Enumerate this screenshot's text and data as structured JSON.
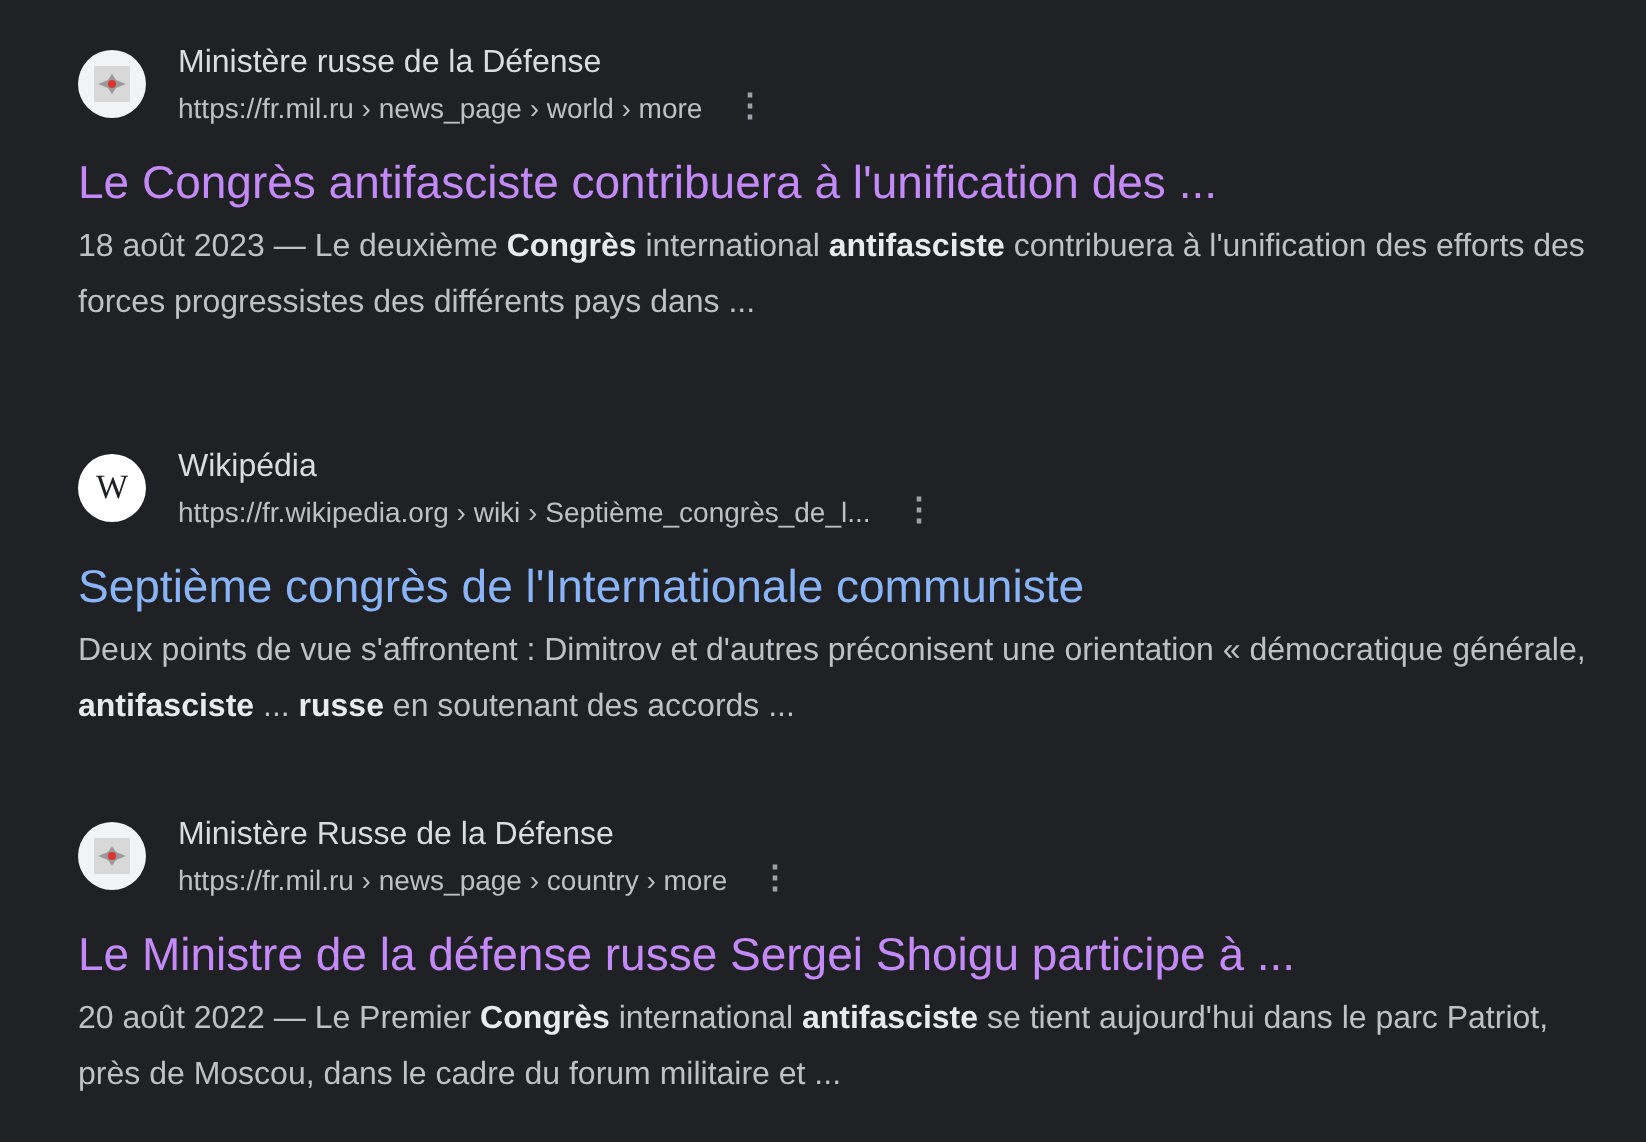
{
  "results": [
    {
      "favicon": {
        "kind": "emblem"
      },
      "site": "Ministère russe de la Défense",
      "url": "https://fr.mil.ru › news_page › world › more",
      "more_icon": "⋮",
      "title": "Le Congrès antifasciste contribuera à l'unification des ...",
      "visited": true,
      "snippet": "18 août 2023 — Le deuxième **Congrès** international **antifasciste** contribuera à l'unification des efforts des forces progressistes des différents pays dans ..."
    },
    {
      "favicon": {
        "kind": "letter",
        "text": "W"
      },
      "site": "Wikipédia",
      "url": "https://fr.wikipedia.org › wiki › Septième_congrès_de_l...",
      "more_icon": "⋮",
      "title": "Septième congrès de l'Internationale communiste",
      "visited": false,
      "snippet": "Deux points de vue s'affrontent : Dimitrov et d'autres préconisent une orientation « démocratique générale, **antifasciste** ... **russe** en soutenant des accords ..."
    },
    {
      "favicon": {
        "kind": "emblem"
      },
      "site": "Ministère Russe de la Défense",
      "url": "https://fr.mil.ru › news_page › country › more",
      "more_icon": "⋮",
      "title": "Le Ministre de la défense russe Sergei Shoigu participe à ...",
      "visited": true,
      "snippet": "20 août 2022 — Le Premier **Congrès** international **antifasciste** se tient aujourd'hui dans le parc Patriot, près de Moscou, dans le cadre du forum militaire et ..."
    }
  ]
}
